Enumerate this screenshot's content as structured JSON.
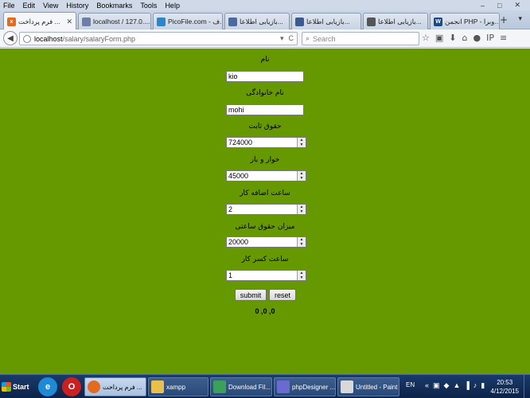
{
  "menubar": {
    "items": [
      "File",
      "Edit",
      "View",
      "History",
      "Bookmarks",
      "Tools",
      "Help"
    ],
    "window_controls": [
      "–",
      "□",
      "✕"
    ]
  },
  "tabs": [
    {
      "label": "فرم پرداخت ...",
      "icon_color": "#e26b1f",
      "active": true
    },
    {
      "label": "localhost / 127.0....",
      "icon_color": "#6b7fa8"
    },
    {
      "label": "PicoFile.com - ف...",
      "icon_color": "#2d86c8"
    },
    {
      "label": "بازیابی اطلاعا...",
      "icon_color": "#4a6aa0"
    },
    {
      "label": "بازیابی اطلاعا...",
      "icon_color": "#3a5a90"
    },
    {
      "label": "بازیابی اطلاعا...",
      "icon_color": "#555555"
    },
    {
      "label": "انجمن PHP - وبرا...",
      "icon_color": "#1a4a8a"
    }
  ],
  "tab_close": "✕",
  "newtab": "+",
  "tabdrop": "▾",
  "navbar": {
    "back": "◀",
    "url_host": "localhost",
    "url_path": "/salary/salaryForm.php",
    "url_icons": [
      "▾",
      "C"
    ],
    "search_placeholder": "Search",
    "search_icon": "⌕",
    "toolbar_icons": [
      "☆",
      "▣",
      "⬇",
      "⌂",
      "●",
      "IP",
      "≡"
    ]
  },
  "form": {
    "fields": [
      {
        "label": "نام",
        "value": "kio",
        "type": "text"
      },
      {
        "label": "نام خانوادگی",
        "value": "mohi",
        "type": "text"
      },
      {
        "label": "حقوق ثابت",
        "value": "724000",
        "type": "number"
      },
      {
        "label": "خوار و بار",
        "value": "45000",
        "type": "number"
      },
      {
        "label": "ساعت اضافه کار",
        "value": "2",
        "type": "number"
      },
      {
        "label": "میزان حقوق ساعتی",
        "value": "20000",
        "type": "number"
      },
      {
        "label": "ساعت کسر کار",
        "value": "1",
        "type": "number"
      }
    ],
    "submit_label": "submit",
    "reset_label": "reset",
    "result": "0 ,0 ,0"
  },
  "taskbar": {
    "start_label": "Start",
    "quick_launch": [
      {
        "glyph": "e",
        "color": "#1e8ad6"
      },
      {
        "glyph": "O",
        "color": "#cc1f1f"
      }
    ],
    "tasks": [
      {
        "label": "فرم پرداخت ...",
        "active": true,
        "icon_color": "#e26b1f"
      },
      {
        "label": "xampp",
        "icon_color": "#e8c04a"
      },
      {
        "label": "Download Fil...",
        "icon_color": "#3aa05a"
      },
      {
        "label": "phpDesigner ...",
        "icon_color": "#6a6ad0"
      },
      {
        "label": "Untitled - Paint",
        "icon_color": "#d8d8d8"
      }
    ],
    "tray": {
      "lang": "EN",
      "icons": [
        "«",
        "▣",
        "◆",
        "▲",
        "▐",
        "♪",
        "▮"
      ],
      "time": "20:53",
      "date": "4/12/2015"
    }
  },
  "colors": {
    "content_bg": "#669900",
    "taskbar_bg": "#0d2348"
  }
}
